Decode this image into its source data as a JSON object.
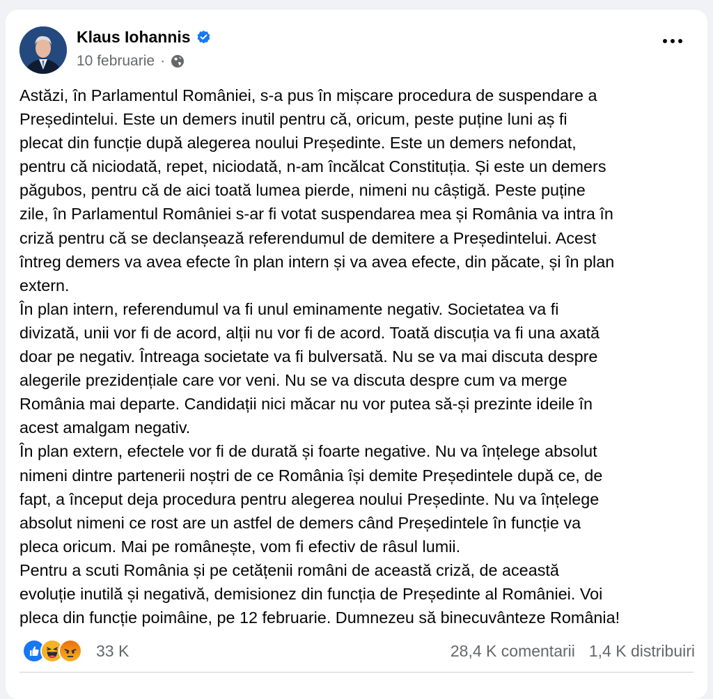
{
  "post": {
    "author": "Klaus Iohannis",
    "verified_icon": "verified-badge-icon",
    "date": "10 februarie",
    "separator": "·",
    "privacy_icon": "globe-icon",
    "more_icon": "more-options-icon",
    "lines": [
      "Astăzi, în Parlamentul României, s-a pus în mișcare procedura de suspendare a",
      "Președintelui. Este un demers inutil pentru că, oricum, peste puține luni aș fi",
      "plecat din funcție după alegerea noului Președinte. Este un demers nefondat,",
      "pentru că niciodată, repet, niciodată, n-am încălcat Constituția. Și este un demers",
      "păgubos, pentru că de aici toată lumea pierde, nimeni nu câștigă. Peste puține",
      "zile, în Parlamentul României s-ar fi votat suspendarea mea și România va intra în",
      "criză pentru că se declanșează referendumul de demitere a Președintelui. Acest",
      "întreg demers va avea efecte în plan intern și va avea efecte, din păcate, și în plan",
      "extern.",
      "În plan intern, referendumul va fi unul eminamente negativ. Societatea va fi",
      "divizată, unii vor fi de acord, alții nu vor fi de acord. Toată discuția va fi una axată",
      "doar pe negativ. Întreaga societate va fi bulversată. Nu se va mai discuta despre",
      "alegerile prezidențiale care vor veni. Nu se va discuta despre cum va merge",
      "România mai departe. Candidații nici măcar nu vor putea să-și prezinte ideile în",
      "acest amalgam negativ.",
      "În plan extern, efectele vor fi de durată și foarte negative. Nu va înțelege absolut",
      "nimeni dintre partenerii noștri de ce România își demite Președintele după ce, de",
      "fapt, a început deja procedura pentru alegerea noului Președinte. Nu va înțelege",
      "absolut nimeni ce rost are un astfel de demers când Președintele în funcție va",
      "pleca oricum. Mai pe românește, vom fi efectiv de râsul lumii.",
      "Pentru a scuti România și pe cetățenii români de această criză, de această",
      "evoluție inutilă și negativă, demisionez din funcția de Președinte al României. Voi",
      "pleca din funcție poimâine, pe 12 februarie. Dumnezeu să binecuvânteze România!"
    ]
  },
  "footer": {
    "reaction_icons": [
      "like-reaction-icon",
      "haha-reaction-icon",
      "angry-reaction-icon"
    ],
    "reaction_count": "33 K",
    "comments": "28,4 K comentarii",
    "shares": "1,4 K distribuiri"
  },
  "colors": {
    "like": "#1877f2",
    "verified": "#1877f2",
    "secondary_text": "#65676b"
  }
}
